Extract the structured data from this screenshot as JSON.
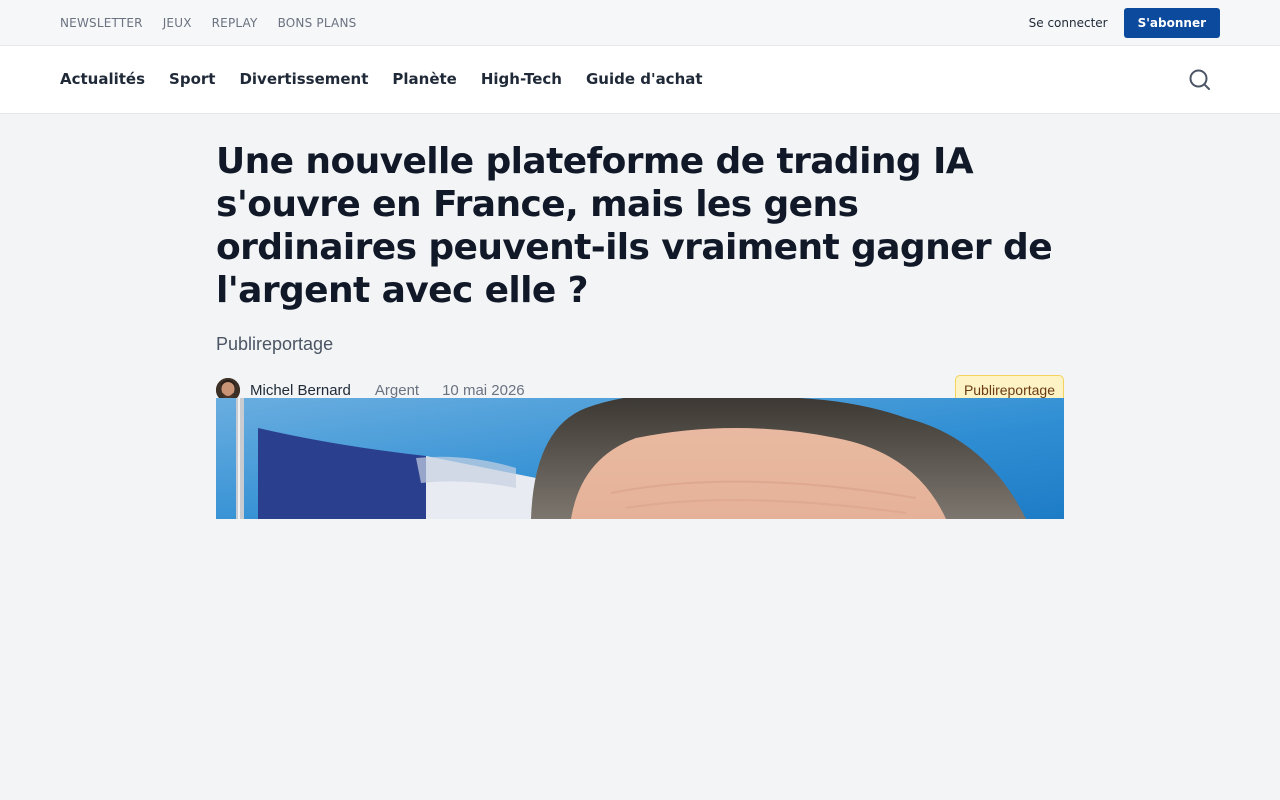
{
  "topbar": {
    "links": [
      "NEWSLETTER",
      "JEUX",
      "REPLAY",
      "BONS PLANS"
    ],
    "login_label": "Se connecter",
    "subscribe_label": "S'abonner"
  },
  "nav": {
    "items": [
      "Actualités",
      "Sport",
      "Divertissement",
      "Planète",
      "High-Tech",
      "Guide d'achat"
    ],
    "search_icon": "search-icon"
  },
  "article": {
    "headline": "Une nouvelle plateforme de trading IA s'ouvre en France, mais les gens ordinaires peuvent-ils vraiment gagner de l'argent avec elle ?",
    "subhead": "Publireportage",
    "author": "Michel Bernard",
    "category": "Argent",
    "date": "10 mai 2026",
    "badge": "Publireportage"
  },
  "colors": {
    "brand": "#0b4a9c",
    "badge_bg": "#fdf3c4",
    "badge_border": "#f3d35c"
  }
}
